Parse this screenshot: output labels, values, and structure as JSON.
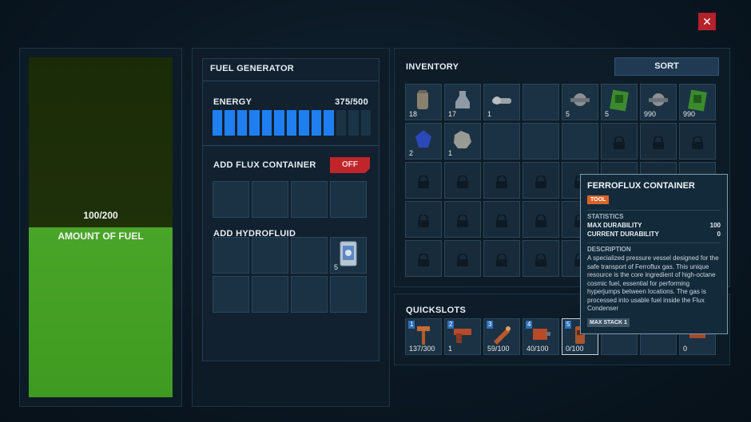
{
  "close": {
    "glyph": "✕"
  },
  "fuel": {
    "count": "100/200",
    "label": "AMOUNT OF FUEL",
    "amount": 100,
    "capacity": 200
  },
  "generator": {
    "title": "FUEL GENERATOR",
    "energy_label": "ENERGY",
    "energy_value": "375/500",
    "energy_segments_on": 10,
    "energy_segments_total": 13,
    "flux_label": "ADD FLUX CONTAINER",
    "flux_toggle": "OFF",
    "hydro_label": "ADD HYDROFLUID",
    "hydro_count": "5"
  },
  "inventory": {
    "title": "INVENTORY",
    "sort_label": "SORT",
    "items": [
      {
        "icon": "canister-icon",
        "count": "18",
        "color": "#8a8070"
      },
      {
        "icon": "flask-icon",
        "count": "17",
        "color": "#8e9aa6"
      },
      {
        "icon": "drill-part-icon",
        "count": "1",
        "color": "#9aa2a8"
      },
      {
        "icon": "empty",
        "count": ""
      },
      {
        "icon": "valve-icon",
        "count": "5",
        "color": "#8a9096"
      },
      {
        "icon": "circuit-board-icon",
        "count": "5",
        "color": "#3a8a2e"
      },
      {
        "icon": "valve-icon",
        "count": "990",
        "color": "#8a9096"
      },
      {
        "icon": "circuit-board-icon",
        "count": "990",
        "color": "#3a8a2e"
      },
      {
        "icon": "crystal-icon",
        "count": "2",
        "color": "#2a48b8"
      },
      {
        "icon": "ore-icon",
        "count": "1",
        "color": "#9a9a94"
      }
    ],
    "unlocked_empty": 3,
    "total_slots": 40
  },
  "quickslots": {
    "title": "QUICKSLOTS",
    "slots": [
      {
        "num": "1",
        "count": "137/300",
        "icon": "hammer-icon"
      },
      {
        "num": "2",
        "count": "1",
        "icon": "pistol-icon"
      },
      {
        "num": "3",
        "count": "59/100",
        "icon": "cutter-icon"
      },
      {
        "num": "4",
        "count": "40/100",
        "icon": "welder-icon"
      },
      {
        "num": "5",
        "count": "0/100",
        "icon": "container-icon"
      },
      {
        "num": "",
        "count": "",
        "icon": "empty"
      },
      {
        "num": "",
        "count": "",
        "icon": "empty"
      },
      {
        "num": "",
        "count": "0",
        "icon": "tool-icon"
      }
    ]
  },
  "tooltip": {
    "title": "FERROFLUX CONTAINER",
    "tag": "TOOL",
    "stats_header": "STATISTICS",
    "max_durability_label": "MAX DURABILITY",
    "max_durability_value": "100",
    "current_durability_label": "CURRENT DURABILITY",
    "current_durability_value": "0",
    "description_header": "DESCRIPTION",
    "description": "A specialized pressure vessel designed for the safe transport of Ferroflux gas. This unique resource is the core ingredient of high-octane cosmic fuel, essential for performing hyperjumps between locations. The gas is processed into usable fuel inside the Flux Condenser",
    "max_stack": "MAX STACK 1"
  },
  "colors": {
    "energy_on": "#1f7ff0",
    "fuel_green": "#49a528",
    "toggle_off": "#c0252a",
    "tag_orange": "#d9642a"
  }
}
